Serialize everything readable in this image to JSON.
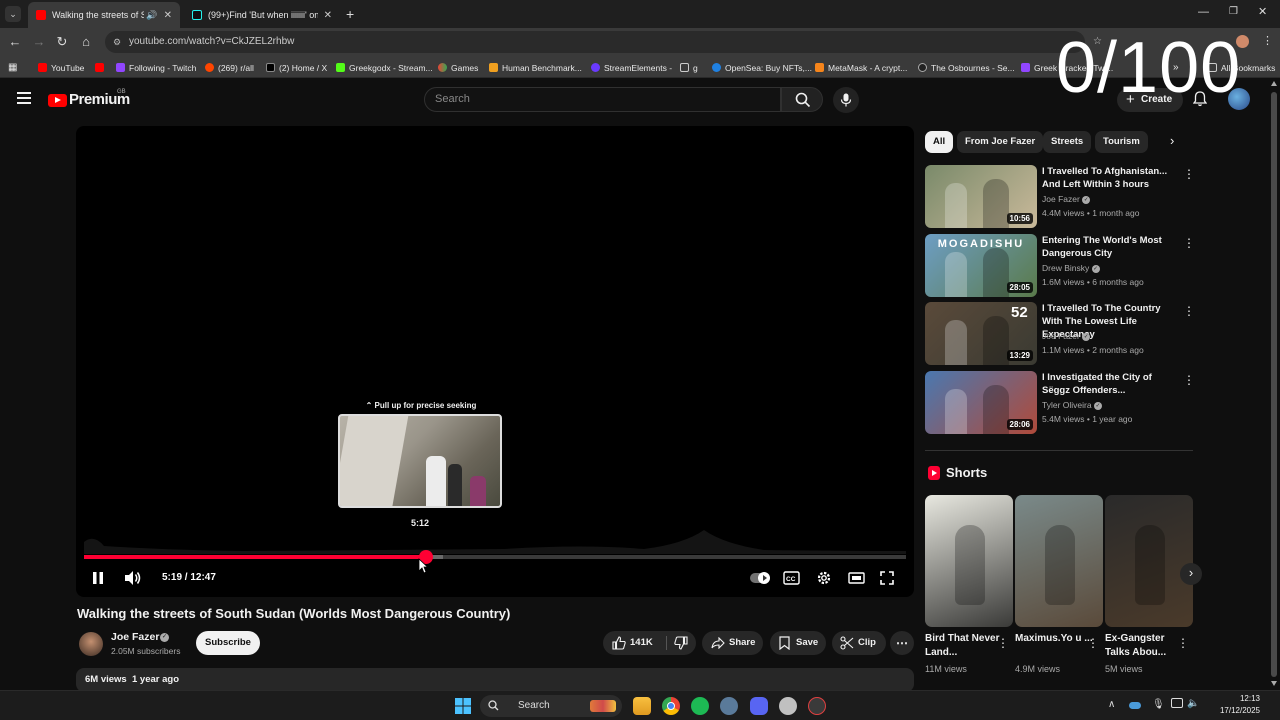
{
  "counter_overlay": "0/100",
  "browser": {
    "tabs": [
      {
        "title": "Walking the streets of South",
        "active": true
      },
      {
        "title": "(99+)Find 'But when iiiiiii' on Ti",
        "active": false
      }
    ],
    "address": "youtube.com/watch?v=CkJZEL2rhbw",
    "bookmarks": [
      "YouTube",
      "Following - Twitch",
      "(269) r/all",
      "(2) Home / X",
      "Greekgodx - Stream...",
      "Games",
      "Human Benchmark...",
      "StreamElements -",
      "g",
      "OpenSea: Buy NFTs,...",
      "MetaMask - A crypt...",
      "The Osbournes - Se...",
      "Greek Cracked Twi...",
      "All Bookmarks"
    ]
  },
  "masthead": {
    "logo_text": "Premium",
    "region": "GB",
    "search_placeholder": "Search",
    "create_label": "Create"
  },
  "player": {
    "seek_hint": "⌃ Pull up for precise seeking",
    "preview_time": "5:12",
    "time_display": "5:19 / 12:47",
    "progress": 0.416,
    "buffered": 0.437
  },
  "video": {
    "title": "Walking the streets of South Sudan (Worlds Most Dangerous Country)",
    "channel": "Joe Fazer",
    "subscribers": "2.05M subscribers",
    "subscribe_label": "Subscribe",
    "likes": "141K",
    "share_label": "Share",
    "save_label": "Save",
    "clip_label": "Clip",
    "views_date": "6M views  1 year ago"
  },
  "chips": [
    "All",
    "From Joe Fazer",
    "Streets",
    "Tourism"
  ],
  "recommendations": [
    {
      "title": "I Travelled To Afghanistan... And Left Within 3 hours",
      "channel": "Joe Fazer",
      "meta": "4.4M views • 1 month ago",
      "duration": "10:56",
      "colors": [
        "#7a8a6a",
        "#c9b99a"
      ]
    },
    {
      "title": "Entering The World's Most Dangerous City",
      "channel": "Drew Binsky",
      "meta": "1.6M views • 6 months ago",
      "duration": "28:05",
      "thumb_text": "MOGADISHU",
      "colors": [
        "#6d9ec4",
        "#5a7a4a"
      ]
    },
    {
      "title": "I Travelled To The Country With The Lowest Life Expectancy",
      "channel": "Joe Fazer",
      "meta": "1.1M views • 2 months ago",
      "duration": "13:29",
      "thumb_badge": "52",
      "colors": [
        "#5a4a3a",
        "#3a3a32"
      ]
    },
    {
      "title": "I Investigated the City of Sëggz Offenders...",
      "channel": "Tyler Oliveira",
      "meta": "5.4M views • 1 year ago",
      "duration": "28:06",
      "colors": [
        "#4a78b0",
        "#b04a3a"
      ]
    }
  ],
  "shorts": {
    "heading": "Shorts",
    "items": [
      {
        "title": "Bird That Never Land...",
        "views": "11M views",
        "colors": [
          "#e8e8e0",
          "#3a3a38"
        ]
      },
      {
        "title": "Maximus.Yo u ...",
        "views": "4.9M views",
        "colors": [
          "#7a8a8a",
          "#5a4a3a"
        ]
      },
      {
        "title": "Ex-Gangster Talks Abou...",
        "views": "5M views",
        "colors": [
          "#2a2a2a",
          "#4a3a2a"
        ]
      }
    ]
  },
  "taskbar": {
    "search_label": "Search",
    "time": "12:13",
    "date": "17/12/2025"
  }
}
